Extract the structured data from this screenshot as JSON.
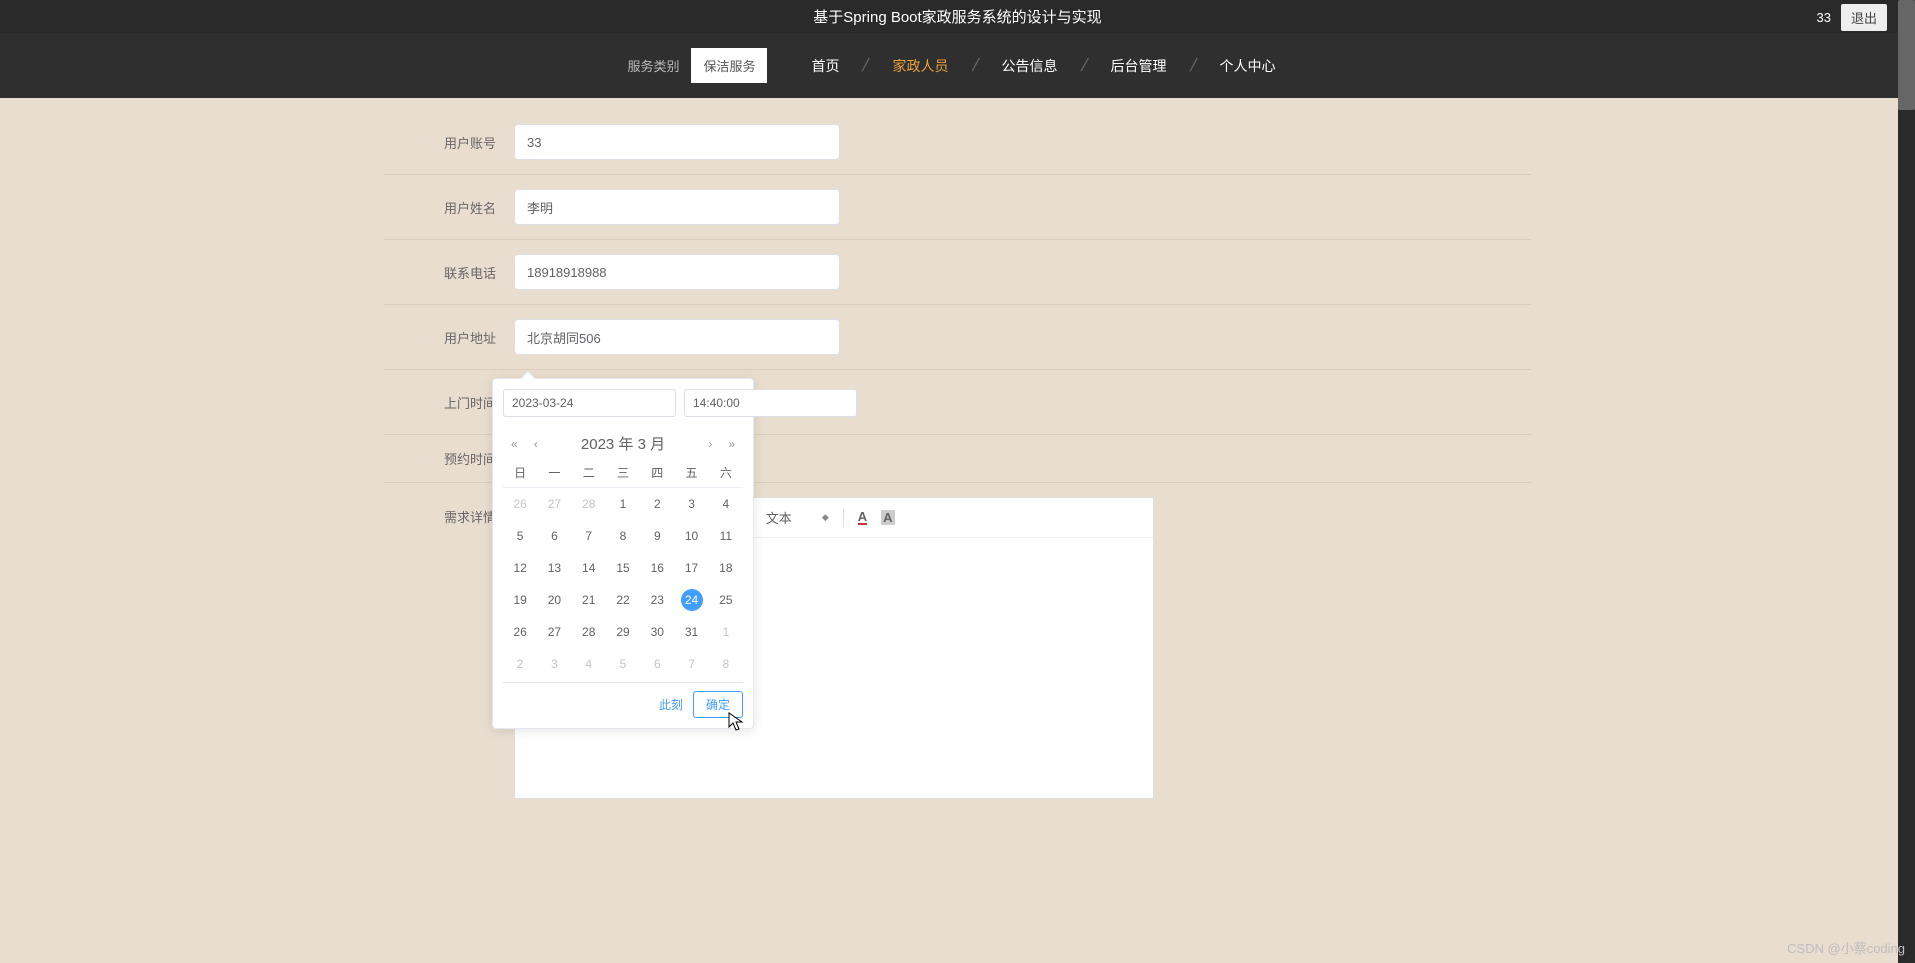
{
  "header": {
    "title": "基于Spring Boot家政服务系统的设计与实现",
    "user_badge": "33",
    "logout": "退出"
  },
  "nav": {
    "category_label": "服务类别",
    "category_value": "保洁服务",
    "items": [
      {
        "label": "首页",
        "active": false
      },
      {
        "label": "家政人员",
        "active": true
      },
      {
        "label": "公告信息",
        "active": false
      },
      {
        "label": "后台管理",
        "active": false
      },
      {
        "label": "个人中心",
        "active": false
      }
    ]
  },
  "form": {
    "account_label": "用户账号",
    "account_value": "33",
    "name_label": "用户姓名",
    "name_value": "李明",
    "phone_label": "联系电话",
    "phone_value": "18918918988",
    "address_label": "用户地址",
    "address_value": "北京胡同506",
    "visit_time_label": "上门时间",
    "visit_time_value": "2023-03-24 14:40:00",
    "appoint_time_label": "预约时间",
    "detail_label": "需求详情"
  },
  "datepicker": {
    "date_value": "2023-03-24",
    "time_value": "14:40:00",
    "title": "2023 年  3 月",
    "weekdays": [
      "日",
      "一",
      "二",
      "三",
      "四",
      "五",
      "六"
    ],
    "now_label": "此刻",
    "confirm_label": "确定",
    "grid": [
      [
        {
          "d": "26",
          "o": true
        },
        {
          "d": "27",
          "o": true
        },
        {
          "d": "28",
          "o": true
        },
        {
          "d": "1"
        },
        {
          "d": "2"
        },
        {
          "d": "3"
        },
        {
          "d": "4"
        }
      ],
      [
        {
          "d": "5"
        },
        {
          "d": "6"
        },
        {
          "d": "7"
        },
        {
          "d": "8"
        },
        {
          "d": "9"
        },
        {
          "d": "10"
        },
        {
          "d": "11"
        }
      ],
      [
        {
          "d": "12"
        },
        {
          "d": "13"
        },
        {
          "d": "14"
        },
        {
          "d": "15"
        },
        {
          "d": "16"
        },
        {
          "d": "17"
        },
        {
          "d": "18"
        }
      ],
      [
        {
          "d": "19"
        },
        {
          "d": "20"
        },
        {
          "d": "21"
        },
        {
          "d": "22"
        },
        {
          "d": "23"
        },
        {
          "d": "24",
          "sel": true
        },
        {
          "d": "25"
        }
      ],
      [
        {
          "d": "26"
        },
        {
          "d": "27"
        },
        {
          "d": "28"
        },
        {
          "d": "29"
        },
        {
          "d": "30"
        },
        {
          "d": "31"
        },
        {
          "d": "1",
          "o": true
        }
      ],
      [
        {
          "d": "2",
          "o": true
        },
        {
          "d": "3",
          "o": true
        },
        {
          "d": "4",
          "o": true
        },
        {
          "d": "5",
          "o": true
        },
        {
          "d": "6",
          "o": true
        },
        {
          "d": "7",
          "o": true
        },
        {
          "d": "8",
          "o": true
        }
      ]
    ]
  },
  "editor": {
    "font_size": "14px",
    "text_label": "文本"
  },
  "watermark": "CSDN @小蔡coding"
}
